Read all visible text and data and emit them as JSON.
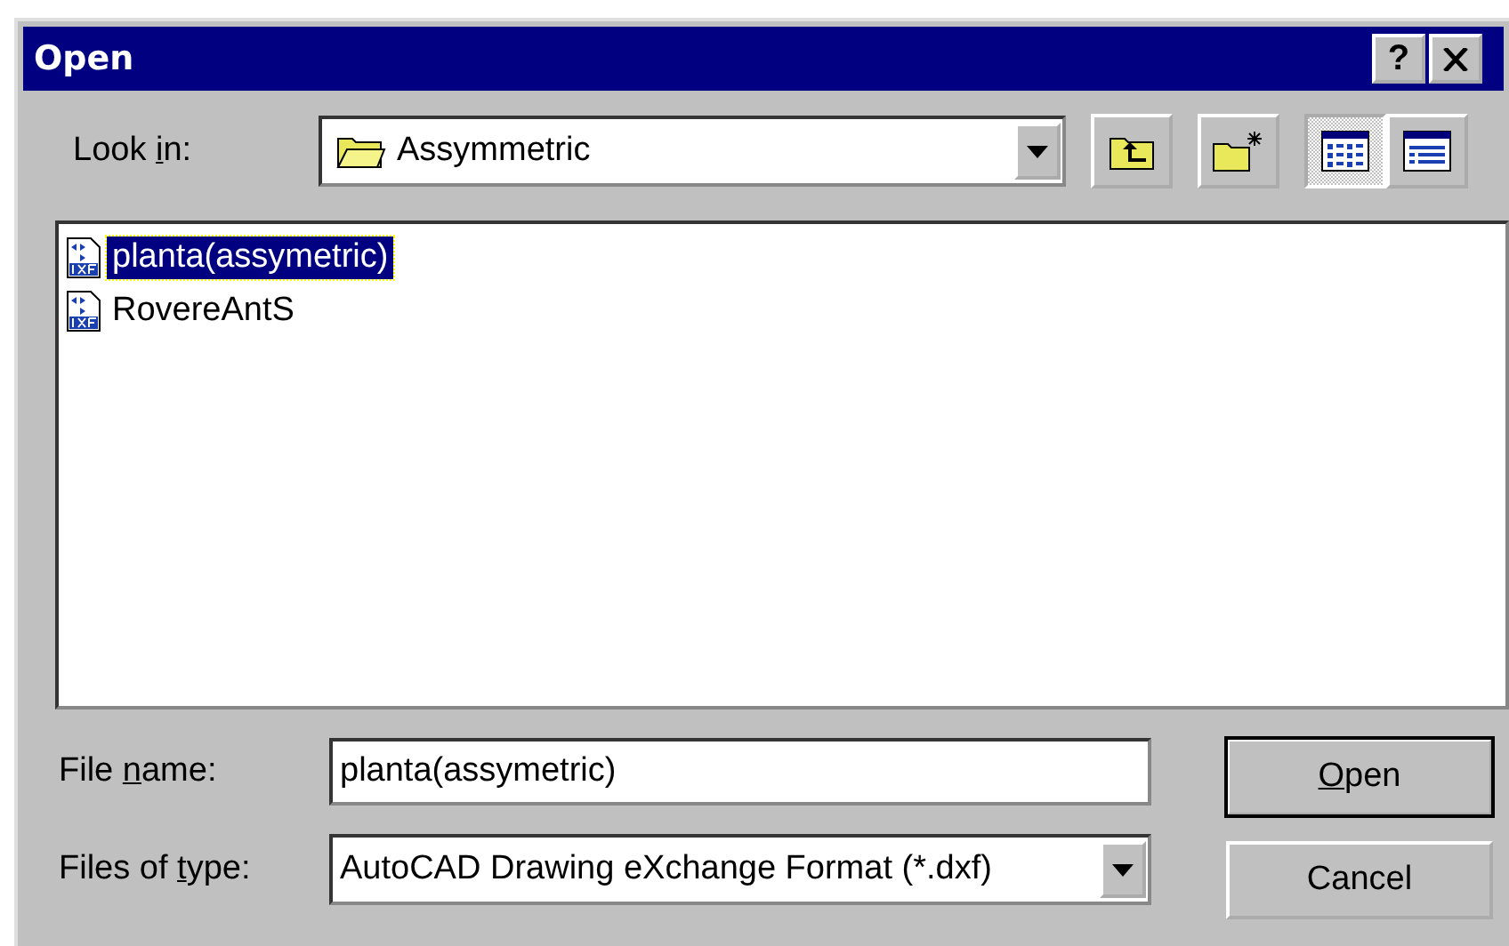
{
  "window": {
    "title": "Open",
    "help_button": "?"
  },
  "look_in": {
    "label": {
      "pre": "Look ",
      "key": "i",
      "post": "n:"
    },
    "value": "Assymmetric"
  },
  "toolbar": [
    {
      "kind": "up"
    },
    {
      "kind": "new"
    },
    {
      "kind": "list",
      "selected": true
    },
    {
      "kind": "details",
      "selected": false
    }
  ],
  "files": [
    {
      "name": "planta(assymetric)",
      "selected": true
    },
    {
      "name": "RovereAntS",
      "selected": false
    }
  ],
  "file_name": {
    "label": {
      "pre": "File ",
      "key": "n",
      "post": "ame:"
    },
    "value": "planta(assymetric)"
  },
  "file_type": {
    "label": {
      "pre": "Files of ",
      "key": "t",
      "post": "ype:"
    },
    "value": "AutoCAD Drawing eXchange Format (*.dxf)"
  },
  "buttons": [
    {
      "label": {
        "key": "O",
        "post": "pen"
      },
      "default": true
    },
    {
      "label": {
        "post": "Cancel"
      },
      "default": false
    }
  ]
}
